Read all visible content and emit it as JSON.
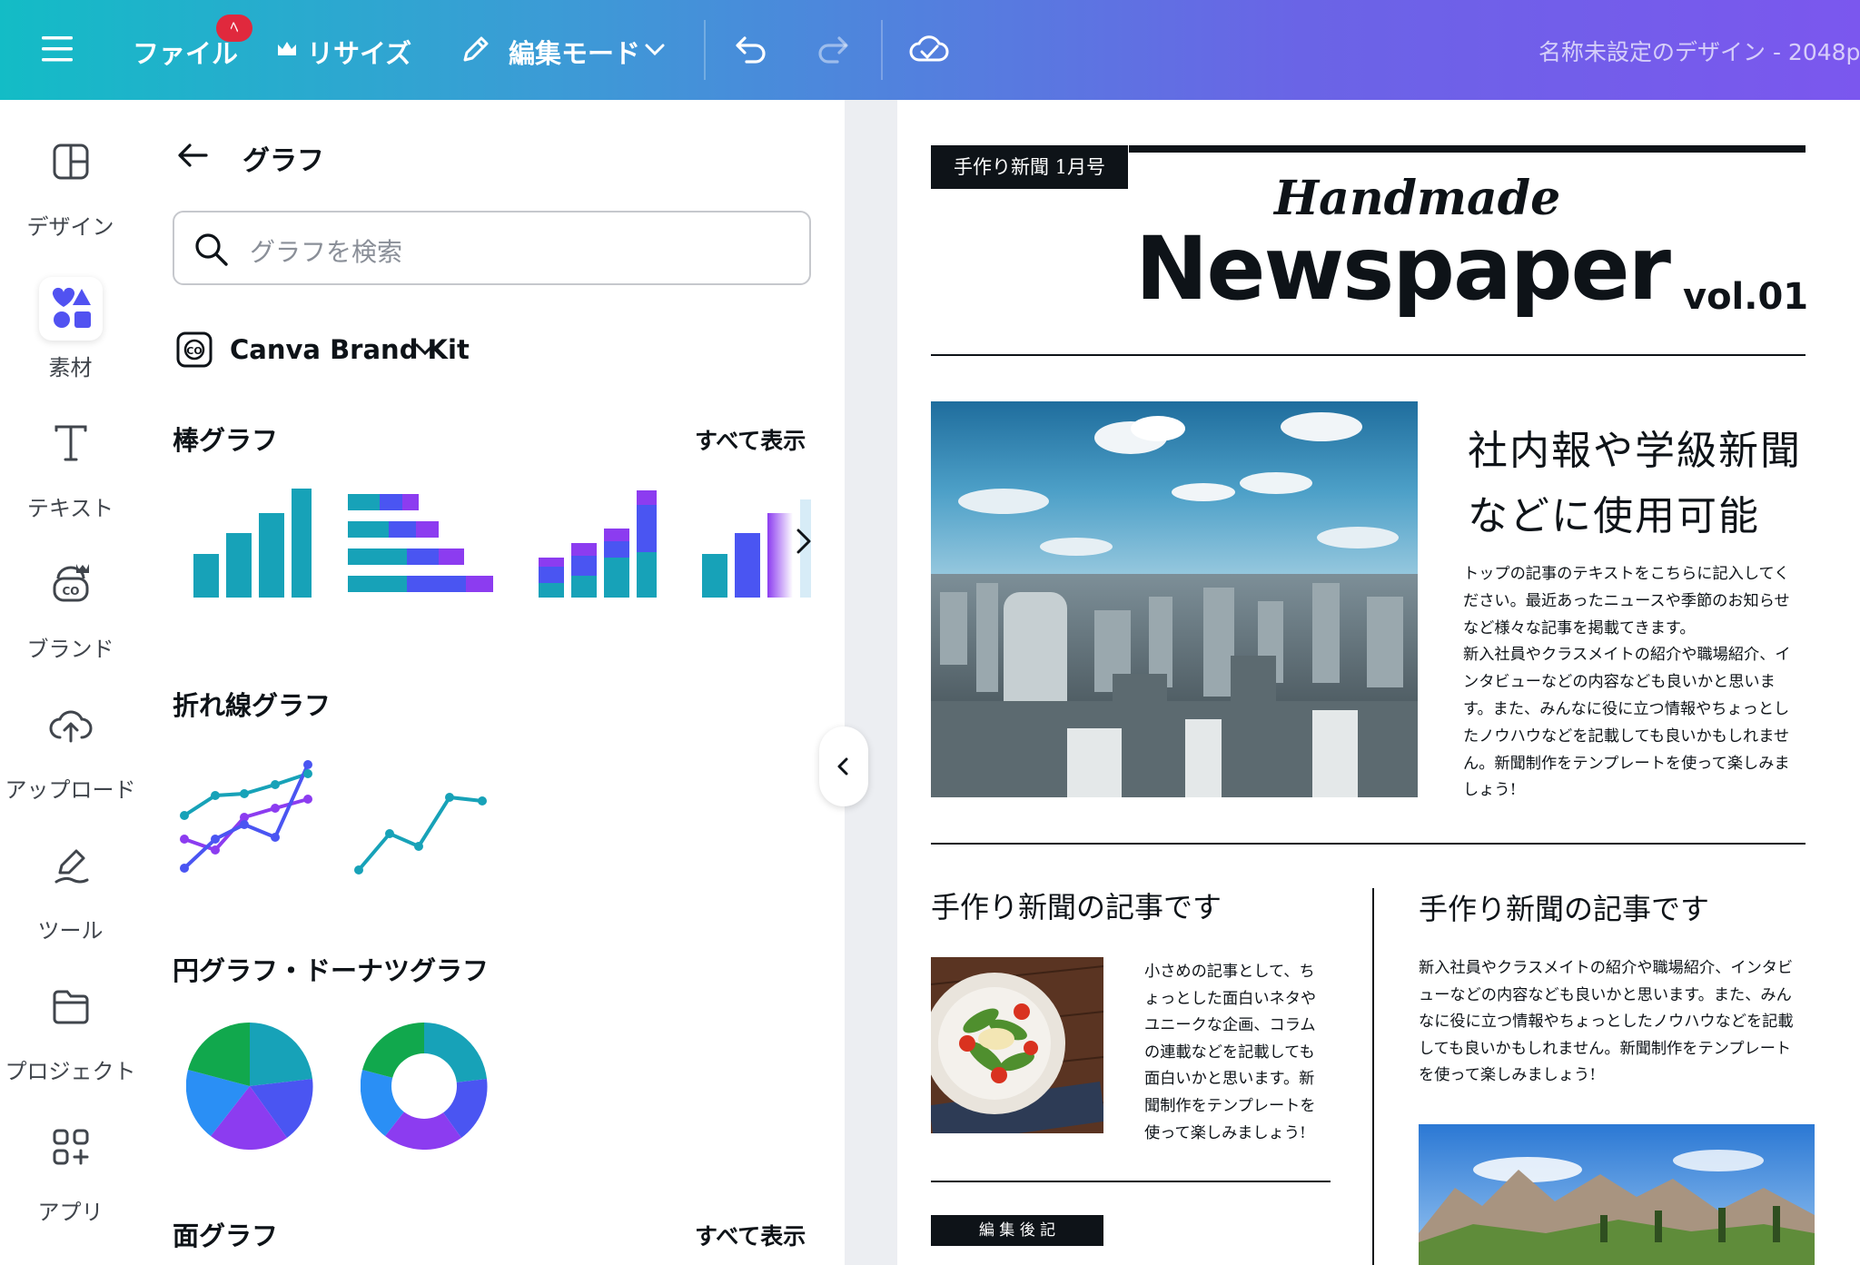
{
  "topbar": {
    "file_label": "ファイル",
    "file_badge": "ﾍ",
    "resize_label": "リサイズ",
    "edit_mode_label": "編集モード",
    "doc_title": "名称未設定のデザイン - 2048p"
  },
  "rail": {
    "items": [
      {
        "label": "デザイン",
        "icon": "layout-icon"
      },
      {
        "label": "素材",
        "icon": "shapes-icon"
      },
      {
        "label": "テキスト",
        "icon": "text-icon"
      },
      {
        "label": "ブランド",
        "icon": "brand-icon"
      },
      {
        "label": "アップロード",
        "icon": "upload-icon"
      },
      {
        "label": "ツール",
        "icon": "pen-tool-icon"
      },
      {
        "label": "プロジェクト",
        "icon": "folder-icon"
      },
      {
        "label": "アプリ",
        "icon": "apps-icon"
      }
    ]
  },
  "panel": {
    "title": "グラフ",
    "search_placeholder": "グラフを検索",
    "brand_kit": "Canva Brand Kit",
    "sections": {
      "bar": {
        "title": "棒グラフ",
        "see_all": "すべて表示"
      },
      "line": {
        "title": "折れ線グラフ"
      },
      "pie": {
        "title": "円グラフ・ドーナツグラフ"
      },
      "area": {
        "title": "面グラフ",
        "see_all": "すべて表示"
      }
    }
  },
  "colors": {
    "teal": "#17a2b8",
    "blue": "#4a55f2",
    "purple": "#8c3cf0",
    "green": "#11a84d",
    "sky": "#2a8ff5"
  },
  "newspaper": {
    "tag": "手作り新聞 1月号",
    "script_title": "Handmade",
    "main_title": "Newspaper",
    "vol": "vol.01",
    "headline_line1": "社内報や学級新聞",
    "headline_line2": "などに使用可能",
    "top_body": [
      "トップの記事のテキストをこちらに記入してく",
      "ださい。最近あったニュースや季節のお知らせ",
      "など様々な記事を掲載てきます。",
      "新入社員やクラスメイトの紹介や職場紹介、イ",
      "ンタビューなどの内容なども良いかと思いま",
      "す。また、みんなに役に立つ情報やちょっとし",
      "たノウハウなどを記載しても良いかもしれませ",
      "ん。新聞制作をテンプレートを使って楽しみま",
      "しょう!"
    ],
    "article_left_title": "手作り新聞の記事です",
    "article_left_body": [
      "小さめの記事として、ち",
      "ょっとした面白いネタや",
      "ユニークな企画、コラム",
      "の連載などを記載しても",
      "面白いかと思います。新",
      "聞制作をテンプレートを",
      "使って楽しみましょう!"
    ],
    "article_right_title": "手作り新聞の記事です",
    "article_right_body": [
      "新入社員やクラスメイトの紹介や職場紹介、インタビ",
      "ューなどの内容なども良いかと思います。また、みん",
      "なに役に立つ情報やちょっとしたノウハウなどを記載",
      "しても良いかもしれません。新聞制作をテンプレート",
      "を使って楽しみましょう!"
    ],
    "editor_note": "編 集 後 記"
  }
}
